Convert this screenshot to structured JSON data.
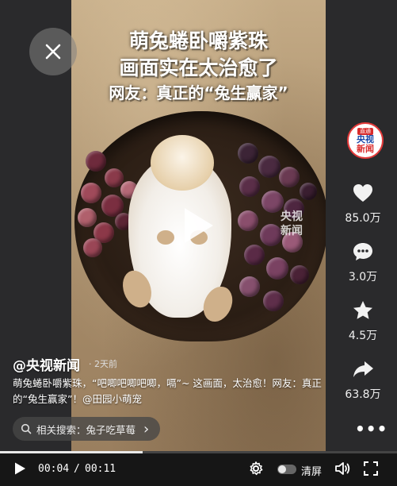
{
  "video": {
    "headline_line1": "萌兔蜷卧嚼紫珠",
    "headline_line2": "画面实在太治愈了",
    "headline_line3": "网友：真正的“兔生赢家”",
    "watermark_line1": "央视",
    "watermark_line2": "新闻"
  },
  "close_icon": "close-icon",
  "rail": {
    "avatar_top": "直通",
    "avatar_line1": "央视",
    "avatar_line2": "新闻",
    "like_count": "85.0万",
    "comment_count": "3.0万",
    "favorite_count": "4.5万",
    "share_count": "63.8万",
    "more_label": "•••"
  },
  "info": {
    "author": "@央视新闻",
    "time": "· 2天前",
    "description": "萌兔蜷卧嚼紫珠，“吧唧吧唧吧唧，嗝”~ 这画面，太治愈！网友：真正的“兔生赢家”！@田园小萌宠",
    "related_label": "相关搜索：兔子吃草莓",
    "related_chevron": "›"
  },
  "player": {
    "current_time": "00:04",
    "separator": "/",
    "duration": "00:11",
    "progress": 0.36,
    "clear_label": "清屏"
  },
  "colors": {
    "accent_red": "#e23a3a",
    "brand_blue": "#1b49a8"
  }
}
